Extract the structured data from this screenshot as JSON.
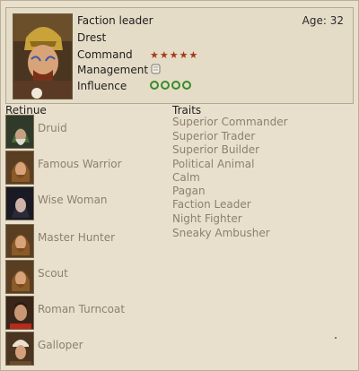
{
  "character": {
    "role": "Faction leader",
    "name": "Drest",
    "age": "Age: 32",
    "command_label": "Command",
    "command_stars": "★★★★★",
    "management_label": "Management",
    "influence_label": "Influence",
    "influence_rings": 4
  },
  "retinue": {
    "title": "Retinue",
    "items": [
      {
        "label": "Druid",
        "icon": "druid-portrait"
      },
      {
        "label": "Famous Warrior",
        "icon": "famous-warrior-portrait"
      },
      {
        "label": "Wise Woman",
        "icon": "wise-woman-portrait"
      },
      {
        "label": "Master Hunter",
        "icon": "master-hunter-portrait"
      },
      {
        "label": "Scout",
        "icon": "scout-portrait"
      },
      {
        "label": "Roman Turncoat",
        "icon": "roman-turncoat-portrait"
      },
      {
        "label": "Galloper",
        "icon": "galloper-portrait"
      }
    ]
  },
  "traits": {
    "title": "Traits",
    "items": [
      "Superior Commander",
      "Superior Trader",
      "Superior Builder",
      "Political Animal",
      "Calm",
      "Pagan",
      "Faction Leader",
      "Night Fighter",
      "Sneaky Ambusher"
    ]
  },
  "colors": {
    "background": "#e8e0cd",
    "muted_text": "#8c806d",
    "star": "#a53a1a",
    "influence": "#3a8a2a"
  }
}
